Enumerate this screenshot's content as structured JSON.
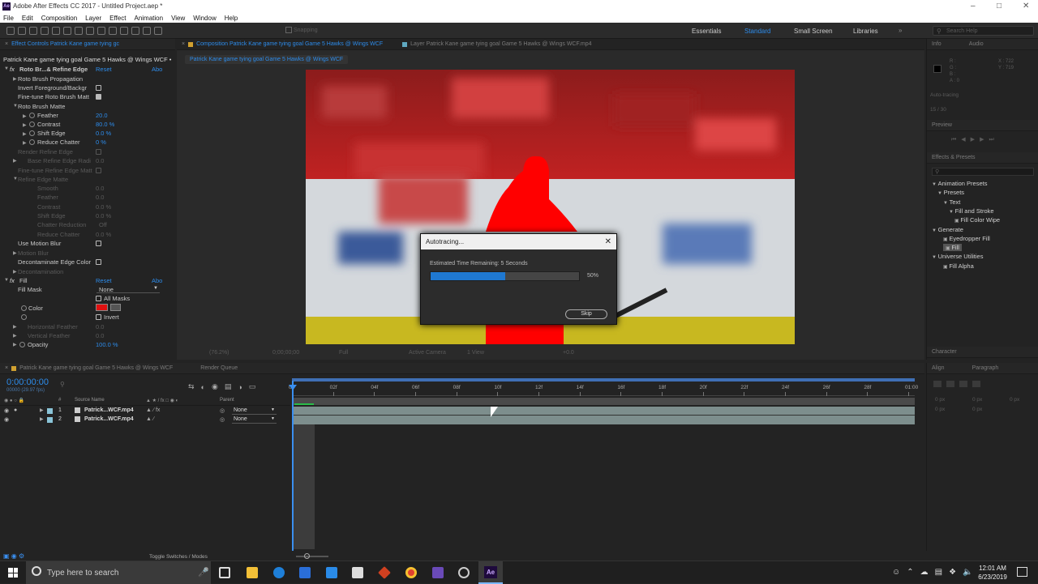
{
  "app": {
    "title": "Adobe After Effects CC 2017 - Untitled Project.aep *",
    "logo": "Ae"
  },
  "menu": [
    "File",
    "Edit",
    "Composition",
    "Layer",
    "Effect",
    "Animation",
    "View",
    "Window",
    "Help"
  ],
  "toolbar": {
    "snapping": "Snapping",
    "workspaces": [
      "Essentials",
      "Standard",
      "Small Screen",
      "Libraries"
    ],
    "search_placeholder": "Search Help"
  },
  "effect_controls": {
    "tab": "Effect Controls Patrick Kane game tying gc",
    "layer_path": "Patrick Kane game tying goal Game 5 Hawks @ Wings WCF •",
    "roto": {
      "name": "Roto Br...& Refine Edge",
      "reset": "Reset",
      "about": "Abo",
      "items": [
        {
          "label": "Roto Brush Propagation"
        },
        {
          "label": "Invert Foreground/Backgr"
        },
        {
          "label": "Fine-tune Roto Brush Matt"
        },
        {
          "label": "Roto Brush Matte"
        },
        {
          "label": "Feather",
          "value": "20.0"
        },
        {
          "label": "Contrast",
          "value": "80.0 %"
        },
        {
          "label": "Shift Edge",
          "value": "0.0 %"
        },
        {
          "label": "Reduce Chatter",
          "value": "0 %"
        },
        {
          "label": "Render Refine Edge"
        },
        {
          "label": "Base Refine Edge Radi",
          "value": "0.0"
        },
        {
          "label": "Fine-tune Refine Edge Matt"
        },
        {
          "label": "Refine Edge Matte"
        },
        {
          "label": "Smooth",
          "value": "0.0"
        },
        {
          "label": "Feather",
          "value": "0.0"
        },
        {
          "label": "Contrast",
          "value": "0.0 %"
        },
        {
          "label": "Shift Edge",
          "value": "0.0 %"
        },
        {
          "label": "Chatter Reduction",
          "value": "Off"
        },
        {
          "label": "Reduce Chatter",
          "value": "0.0 %"
        },
        {
          "label": "Use Motion Blur"
        },
        {
          "label": "Motion Blur"
        },
        {
          "label": "Decontaminate Edge Color"
        },
        {
          "label": "Decontamination"
        }
      ]
    },
    "fill": {
      "name": "Fill",
      "reset": "Reset",
      "about": "Abo",
      "fill_mask": "Fill Mask",
      "mask_value": "None",
      "all_masks": "All Masks",
      "color": "Color",
      "color_hex": "#e01010",
      "invert": "Invert",
      "h_feather": "Horizontal Feather",
      "v_feather": "Vertical Feather",
      "h_val": "0.0",
      "v_val": "0.0",
      "opacity": "Opacity",
      "opacity_val": "100.0 %"
    }
  },
  "composition": {
    "tab": "Composition Patrick Kane game tying goal Game 5 Hawks @ Wings WCF",
    "layer_tab": "Layer Patrick Kane game tying goal Game 5 Hawks @ Wings WCF.mp4",
    "breadcrumb": "Patrick Kane game tying goal Game 5 Hawks @ Wings WCF",
    "zoom": "(76.2%)",
    "time": "0;00;00;00",
    "quality": "Full",
    "camera": "Active Camera",
    "views": "1 View",
    "exposure": "+0.0"
  },
  "dialog": {
    "title": "Autotracing...",
    "message": "Estimated Time Remaining: 5 Seconds",
    "progress_percent": 50,
    "progress_label": "50%",
    "skip": "Skip"
  },
  "timeline": {
    "tab": "Patrick Kane game tying goal Game 5 Hawks @ Wings WCF",
    "render_queue": "Render Queue",
    "timecode": "0:00:00:00",
    "timecode_sub": "00000 (29.97 fps)",
    "col_num": "#",
    "col_source": "Source Name",
    "col_parent": "Parent",
    "ticks": [
      "0f",
      "02f",
      "04f",
      "06f",
      "08f",
      "10f",
      "12f",
      "14f",
      "16f",
      "18f",
      "20f",
      "22f",
      "24f",
      "26f",
      "28f",
      "01:00"
    ],
    "layers": [
      {
        "num": "1",
        "name": "Patrick...WCF.mp4",
        "parent": "None"
      },
      {
        "num": "2",
        "name": "Patrick...WCF.mp4",
        "parent": "None"
      }
    ],
    "toggle": "Toggle Switches / Modes"
  },
  "info": {
    "tab": "Info",
    "audio": "Audio",
    "r": "R :",
    "g": "G :",
    "b": "B :",
    "a": "A : 0",
    "x": "X : 722",
    "y": "Y : 719",
    "autotracing": "Auto-tracing",
    "frames": "15 / 30"
  },
  "preview": {
    "tab": "Preview"
  },
  "effects_presets": {
    "tab": "Effects & Presets",
    "items": [
      {
        "label": "Animation Presets",
        "indent": 0
      },
      {
        "label": "Presets",
        "indent": 1
      },
      {
        "label": "Text",
        "indent": 2
      },
      {
        "label": "Fill and Stroke",
        "indent": 3
      },
      {
        "label": "Fill Color Wipe",
        "indent": 4
      },
      {
        "label": "Generate",
        "indent": 0
      },
      {
        "label": "Eyedropper Fill",
        "indent": 2
      },
      {
        "label": "Fill",
        "indent": 2
      },
      {
        "label": "Universe Utilities",
        "indent": 0
      },
      {
        "label": "Fill Alpha",
        "indent": 2
      }
    ]
  },
  "character": {
    "tab": "Character"
  },
  "align": {
    "tab": "Align",
    "paragraph": "Paragraph",
    "px1": "0 px",
    "px2": "0 px",
    "px3": "0 px",
    "px4": "0 px",
    "px5": "0 px"
  },
  "taskbar": {
    "search": "Type here to search",
    "time": "12:01 AM",
    "date": "6/23/2019"
  },
  "colors": {
    "accent": "#2d8ceb",
    "progress": "#1f78d1",
    "red_matte": "#ff0000",
    "playhead": "#3a8ff0"
  }
}
